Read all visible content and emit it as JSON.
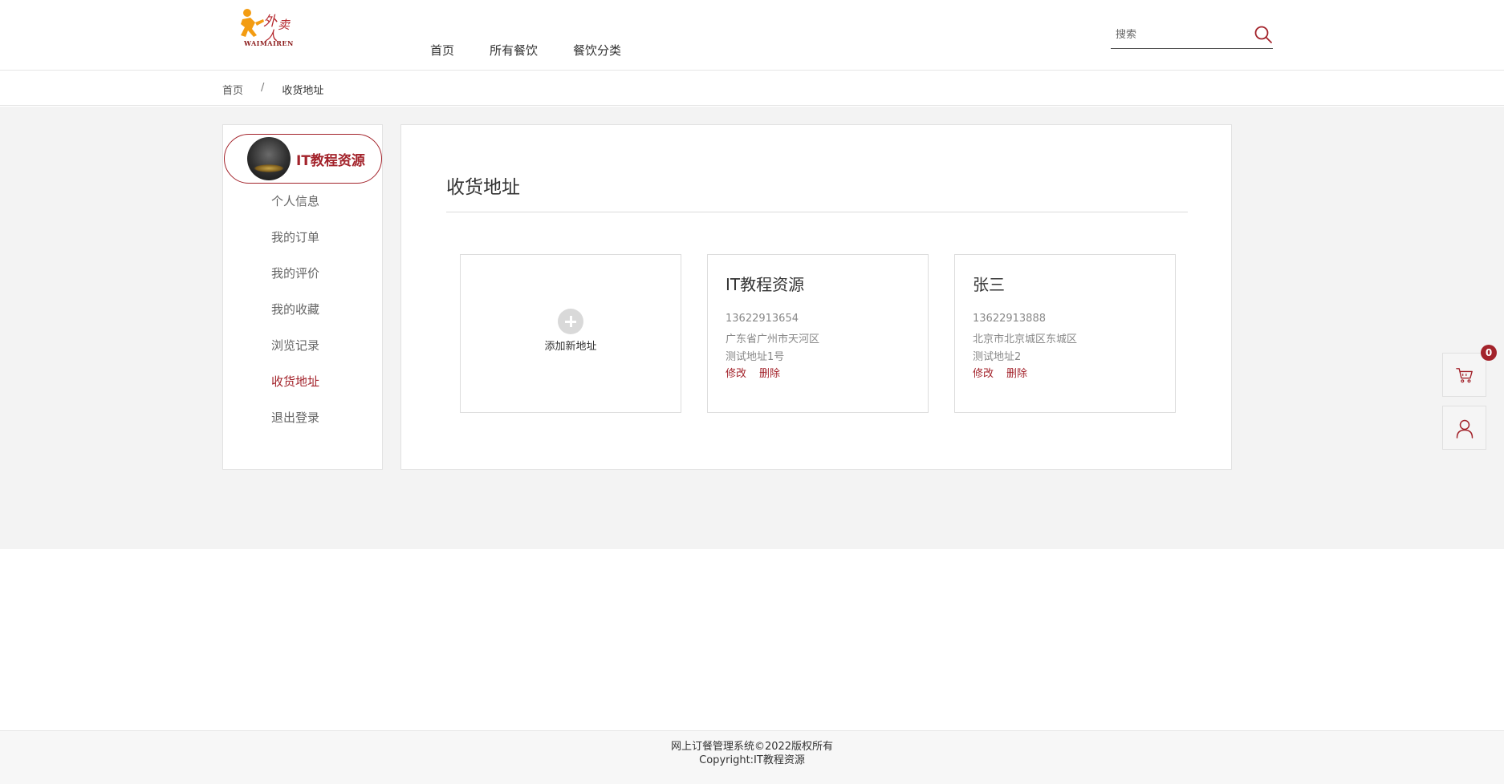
{
  "header": {
    "logo_text": "外卖人",
    "logo_sub": "WAIMAIREN",
    "nav": [
      {
        "label": "首页"
      },
      {
        "label": "所有餐饮"
      },
      {
        "label": "餐饮分类"
      }
    ],
    "search_placeholder": "搜索",
    "search_icon": "search-icon"
  },
  "breadcrumb": {
    "home": "首页",
    "separator": "/",
    "current": "收货地址"
  },
  "sidebar": {
    "username": "IT教程资源",
    "items": [
      {
        "label": "个人信息"
      },
      {
        "label": "我的订单"
      },
      {
        "label": "我的评价"
      },
      {
        "label": "我的收藏"
      },
      {
        "label": "浏览记录"
      },
      {
        "label": "收货地址",
        "active": true
      },
      {
        "label": "退出登录"
      }
    ]
  },
  "content": {
    "title": "收货地址",
    "add_label": "添加新地址",
    "addresses": [
      {
        "name": "IT教程资源",
        "phone": "13622913654",
        "region": "广东省广州市天河区",
        "detail": "测试地址1号",
        "edit": "修改",
        "delete": "删除"
      },
      {
        "name": "张三",
        "phone": "13622913888",
        "region": "北京市北京城区东城区",
        "detail": "测试地址2",
        "edit": "修改",
        "delete": "删除"
      }
    ]
  },
  "float": {
    "cart_count": "0",
    "cart_icon": "cart-icon",
    "user_icon": "user-icon"
  },
  "footer": {
    "line1": "网上订餐管理系统©2022版权所有",
    "line2": "Copyright:IT教程资源"
  },
  "colors": {
    "accent": "#a3232b",
    "background": "#f3f3f3",
    "logo_orange": "#f39c12"
  }
}
